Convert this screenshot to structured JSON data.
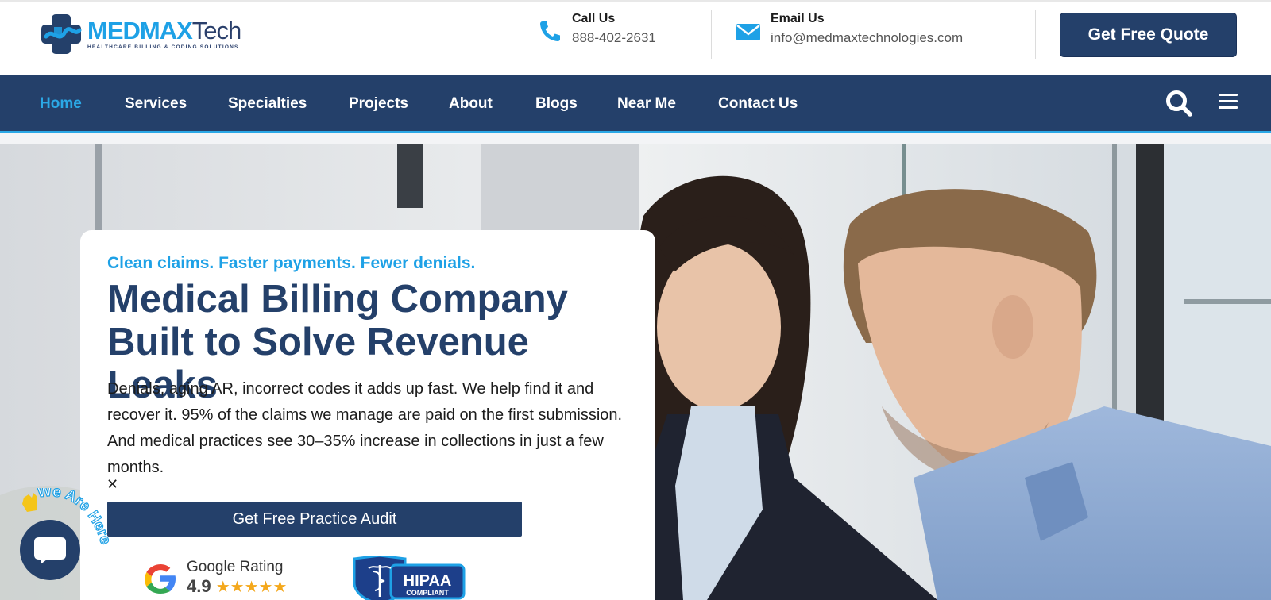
{
  "brand": {
    "name_main": "MEDMAX",
    "name_tech": "Tech",
    "tagline": "HEALTHCARE BILLING & CODING SOLUTIONS"
  },
  "contact": {
    "call_label": "Call Us",
    "phone": "888-402-2631",
    "email_label": "Email Us",
    "email": "info@medmaxtechnologies.com"
  },
  "header": {
    "quote_button": "Get Free Quote"
  },
  "nav": {
    "items": [
      {
        "label": "Home",
        "active": true
      },
      {
        "label": "Services",
        "active": false
      },
      {
        "label": "Specialties",
        "active": false
      },
      {
        "label": "Projects",
        "active": false
      },
      {
        "label": "About",
        "active": false
      },
      {
        "label": "Blogs",
        "active": false
      },
      {
        "label": "Near Me",
        "active": false
      },
      {
        "label": "Contact Us",
        "active": false
      }
    ]
  },
  "hero": {
    "kicker": "Clean claims. Faster payments. Fewer denials.",
    "headline": "Medical Billing Company Built to Solve Revenue Leaks",
    "body": "Denials, aging AR, incorrect codes it adds up fast.  We help find it and recover it. 95% of the claims we manage are paid on the first submission. And medical practices see 30–35% increase in collections in just a few months.",
    "cta": "Get Free Practice Audit",
    "rating_label": "Google Rating",
    "rating_value": "4.9",
    "rating_stars": "★★★★★",
    "hipaa_line1": "HIPAA",
    "hipaa_line2": "COMPLIANT"
  },
  "chat": {
    "badge_text": "We Are Here"
  },
  "colors": {
    "navy": "#24406a",
    "accent_blue": "#2ba8e6",
    "star_gold": "#f4a81c"
  }
}
